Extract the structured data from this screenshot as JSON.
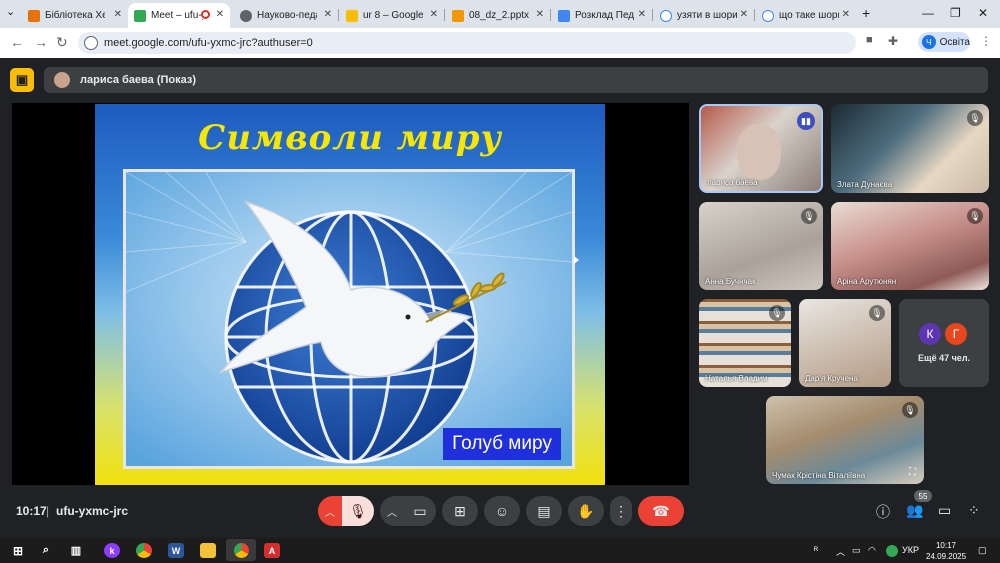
{
  "browser": {
    "tabs": [
      {
        "label": "Бібліотека Херсо",
        "color": "#e8710a"
      },
      {
        "label": "Meet – ufu-y",
        "color": "#34a853",
        "active": true
      },
      {
        "label": "Науково-педаго",
        "color": "#5f6368"
      },
      {
        "label": "ur 8 – Google Ди",
        "color": "#fbbc04"
      },
      {
        "label": "08_dz_2.pptx - G",
        "color": "#f29900"
      },
      {
        "label": "Розклад Пед. пр",
        "color": "#4285f4"
      },
      {
        "label": "узяти в шори зн",
        "color": "#4285f4"
      },
      {
        "label": "що таке шори -",
        "color": "#4285f4"
      }
    ],
    "url": "meet.google.com/ufu-yxmc-jrc?authuser=0",
    "profile_initial": "Ч",
    "profile_label": "Освіта"
  },
  "meet": {
    "presenter_label": "лариса баева (Показ)",
    "slide": {
      "title": "Символи миру",
      "caption": "Голуб миру"
    },
    "participants": [
      {
        "name": "лариса баева",
        "status": "speaking"
      },
      {
        "name": "Злата Дунаєва",
        "status": "muted"
      },
      {
        "name": "Анна Бучнчак",
        "status": "muted"
      },
      {
        "name": "Аріна Арутюнян",
        "status": "muted"
      },
      {
        "name": "Наталья Владим",
        "status": "muted"
      },
      {
        "name": "Дар'я Кручена",
        "status": "muted"
      },
      {
        "name": "Чумак Крістіна Віталіївна",
        "status": "muted"
      }
    ],
    "more": {
      "avatars": [
        {
          "letter": "К",
          "color": "#5e35b1"
        },
        {
          "letter": "Г",
          "color": "#e8471d"
        }
      ],
      "label": "Ещё 47 чел."
    },
    "time": "10:17",
    "meeting_code": "ufu-yxmc-jrc",
    "people_count": "55"
  },
  "taskbar": {
    "language": "УКР",
    "time": "10:17",
    "date": "24.09.2025"
  }
}
